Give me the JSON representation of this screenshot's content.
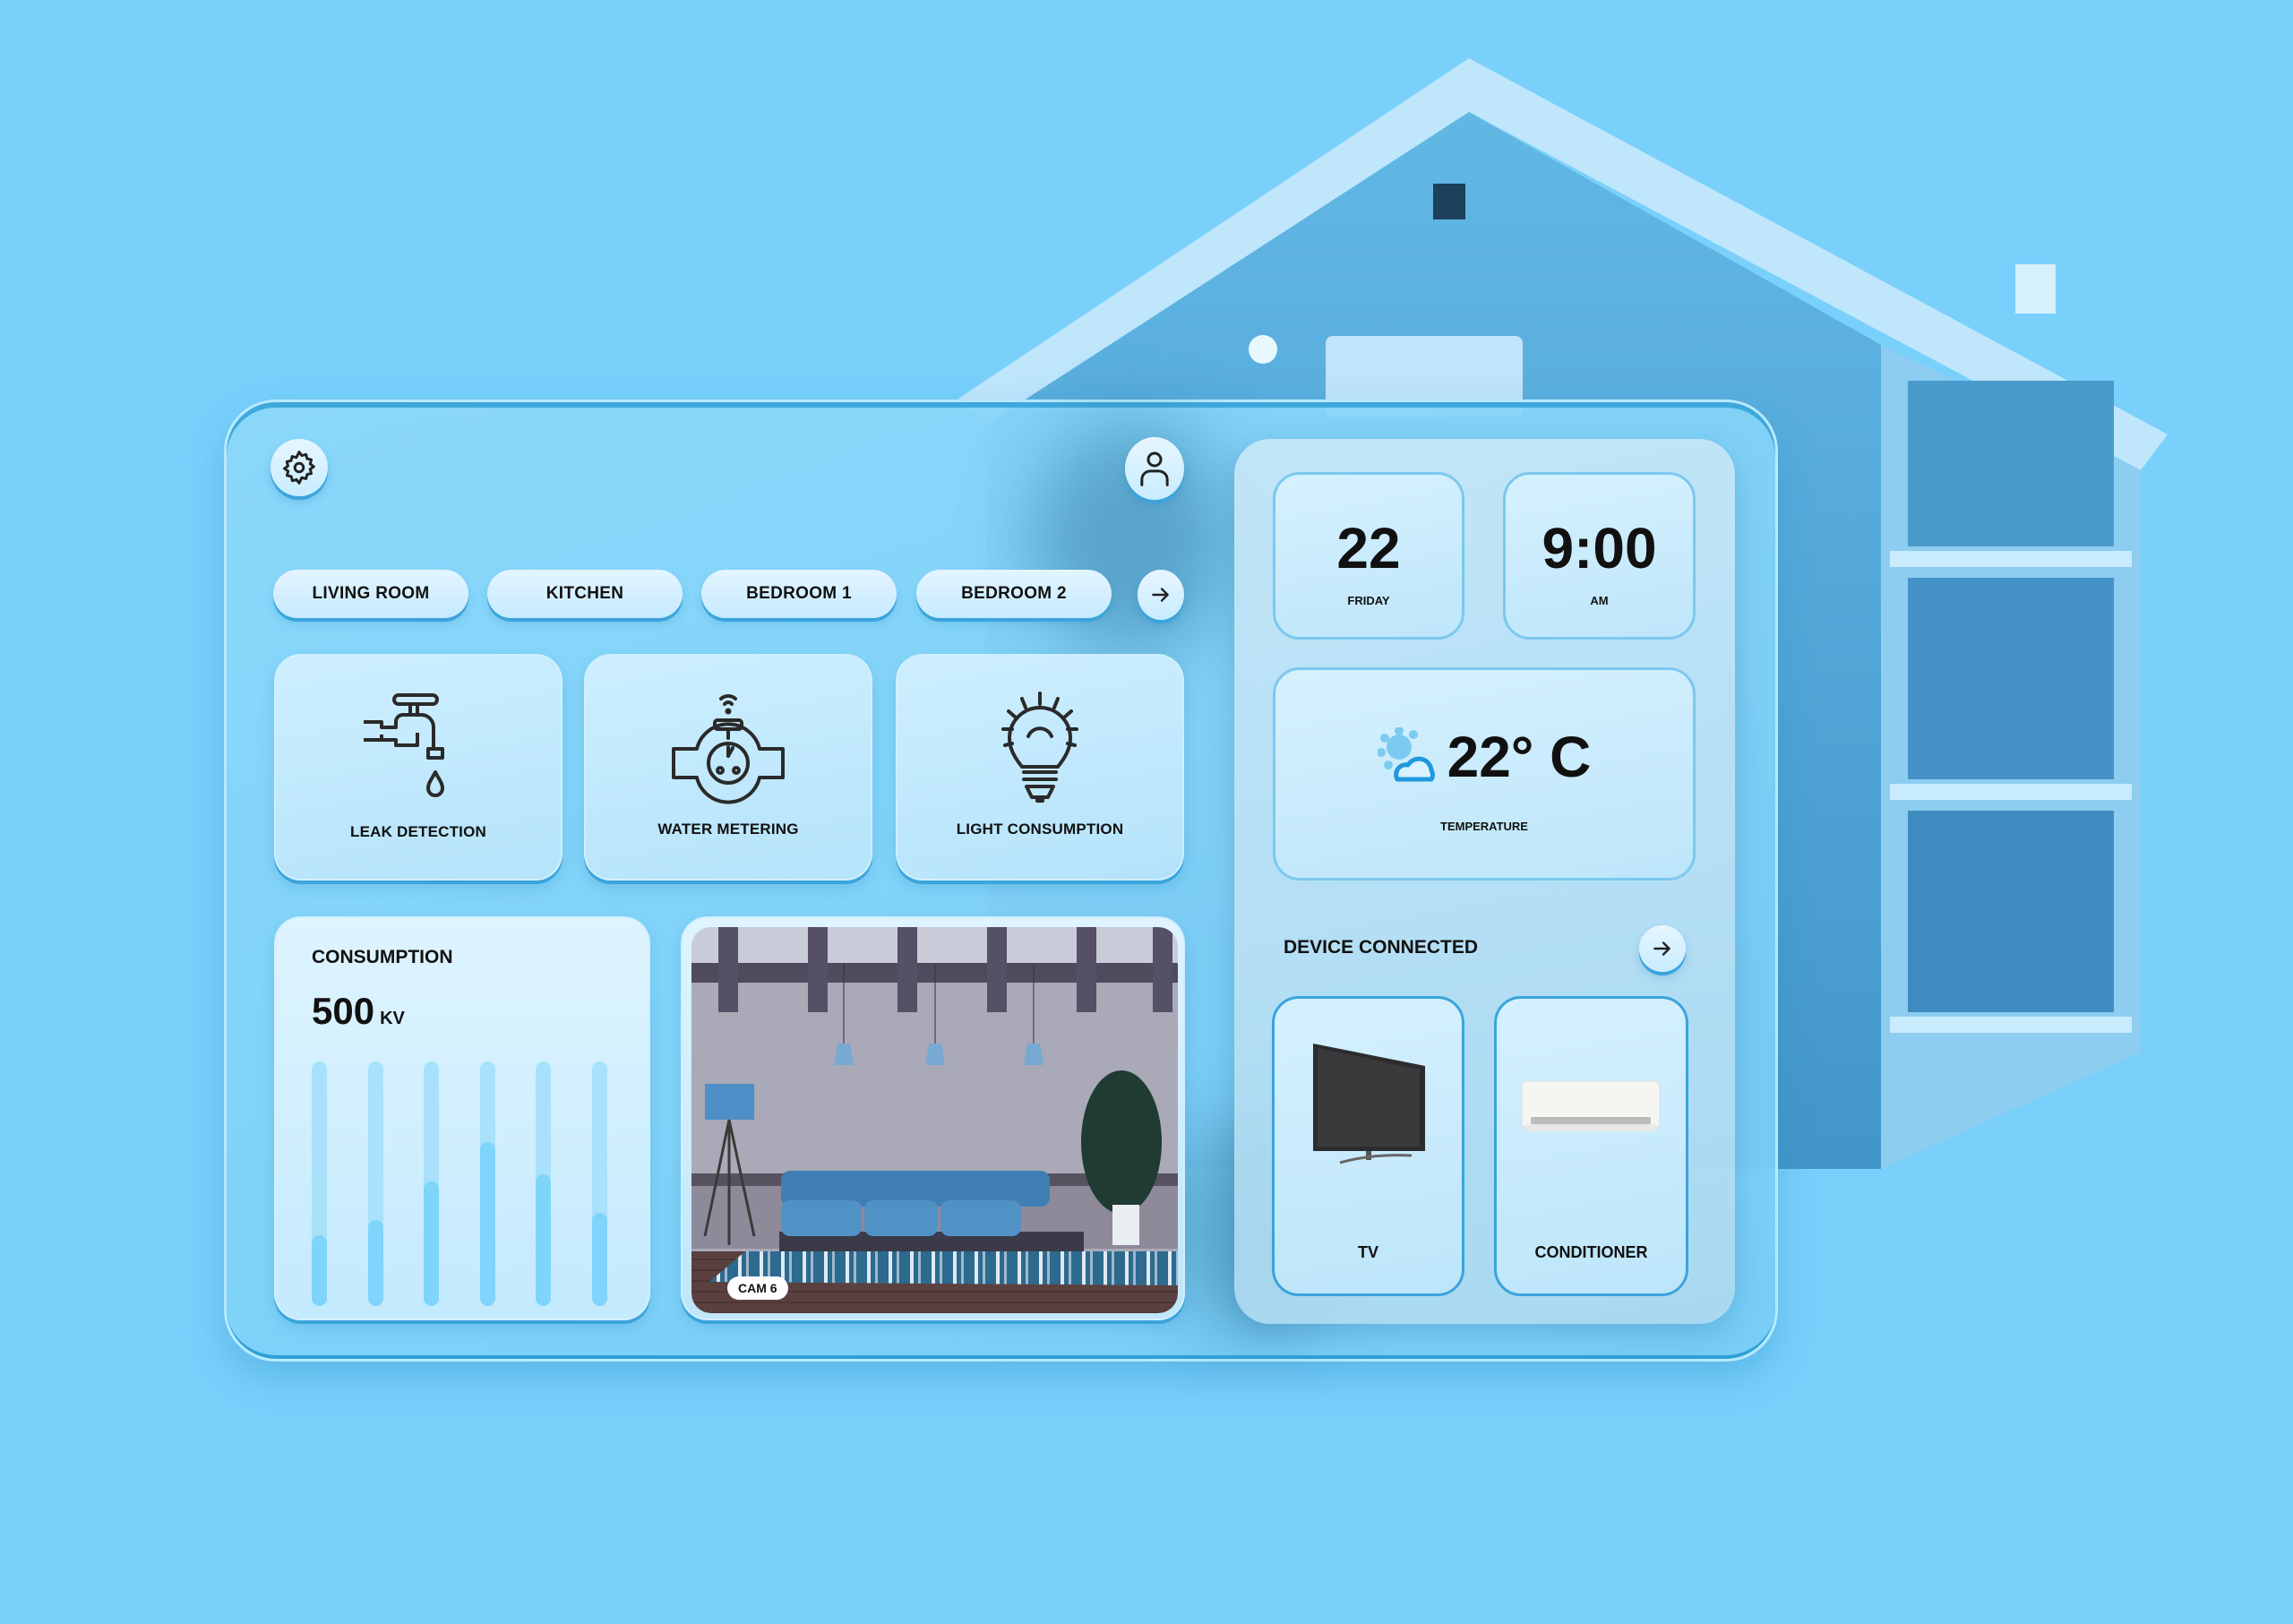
{
  "header": {
    "settings_icon": "gear-icon",
    "profile_icon": "user-icon"
  },
  "rooms": {
    "tabs": [
      {
        "label": "LIVING ROOM"
      },
      {
        "label": "KITCHEN"
      },
      {
        "label": "BEDROOM 1"
      },
      {
        "label": "BEDROOM 2"
      }
    ],
    "next_icon": "arrow-right-icon"
  },
  "features": [
    {
      "label": "LEAK DETECTION",
      "icon": "faucet-drop-icon"
    },
    {
      "label": "WATER METERING",
      "icon": "water-meter-icon"
    },
    {
      "label": "LIGHT CONSUMPTION",
      "icon": "light-bulb-icon"
    }
  ],
  "consumption": {
    "title": "CONSUMPTION",
    "value": "500",
    "unit": "KV",
    "bar_levels": [
      0.29,
      0.35,
      0.51,
      0.67,
      0.54,
      0.38
    ]
  },
  "camera": {
    "label": "CAM 6"
  },
  "date": {
    "day_number": "22",
    "weekday": "FRIDAY"
  },
  "time": {
    "value": "9:00",
    "period": "AM"
  },
  "weather": {
    "temperature": "22° C",
    "label": "TEMPERATURE",
    "icon": "partly-cloudy-icon"
  },
  "devices": {
    "title": "DEVICE CONNECTED",
    "items": [
      {
        "label": "TV"
      },
      {
        "label": "CONDITIONER"
      }
    ]
  },
  "colors": {
    "background": "#79d0fb",
    "accent": "#3aa4dc",
    "bar_fill": "#7fd4fb",
    "bar_track": "#a9e1fb"
  }
}
